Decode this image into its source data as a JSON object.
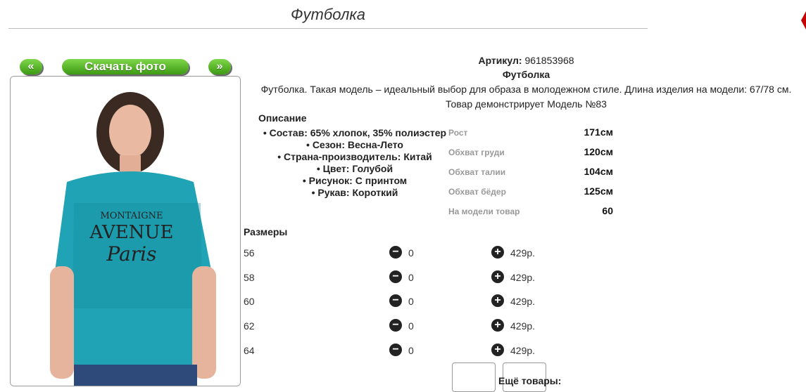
{
  "page": {
    "title": "Футболка"
  },
  "nav": {
    "prev_label": "«",
    "download_label": "Скачать фото",
    "next_label": "»"
  },
  "product": {
    "article_label": "Артикул:",
    "article_value": "961853968",
    "name": "Футболка",
    "description": "Футболка. Такая модель – идеальный выбор для образа в молодежном стиле. Длина изделия на модели: 67/78 см.",
    "model_note": "Товар демонстрирует Модель №83"
  },
  "description_section": {
    "heading": "Описание",
    "items": [
      "• Состав: 65% хлопок, 35% полиэстер",
      "• Сезон: Весна-Лето",
      "• Страна-производитель: Китай",
      "• Цвет: Голубой",
      "• Рисунок: С принтом",
      "• Рукав: Короткий"
    ]
  },
  "measurements": [
    {
      "label": "Рост",
      "value": "171см"
    },
    {
      "label": "Обхват груди",
      "value": "120см"
    },
    {
      "label": "Обхват талии",
      "value": "104см"
    },
    {
      "label": "Обхват бёдер",
      "value": "125см"
    },
    {
      "label": "На модели товар",
      "value": "60"
    }
  ],
  "sizes": {
    "heading": "Размеры",
    "rows": [
      {
        "size": "56",
        "qty": "0",
        "price": "429р."
      },
      {
        "size": "58",
        "qty": "0",
        "price": "429р."
      },
      {
        "size": "60",
        "qty": "0",
        "price": "429р."
      },
      {
        "size": "62",
        "qty": "0",
        "price": "429р."
      },
      {
        "size": "64",
        "qty": "0",
        "price": "429р."
      }
    ]
  },
  "more": {
    "heading": "Ещё товары:"
  },
  "colors": {
    "button_green": "#4caf1f",
    "shirt": "#1fa3b5"
  },
  "icons": {
    "minus": "minus-circle-icon",
    "plus": "plus-circle-icon"
  }
}
